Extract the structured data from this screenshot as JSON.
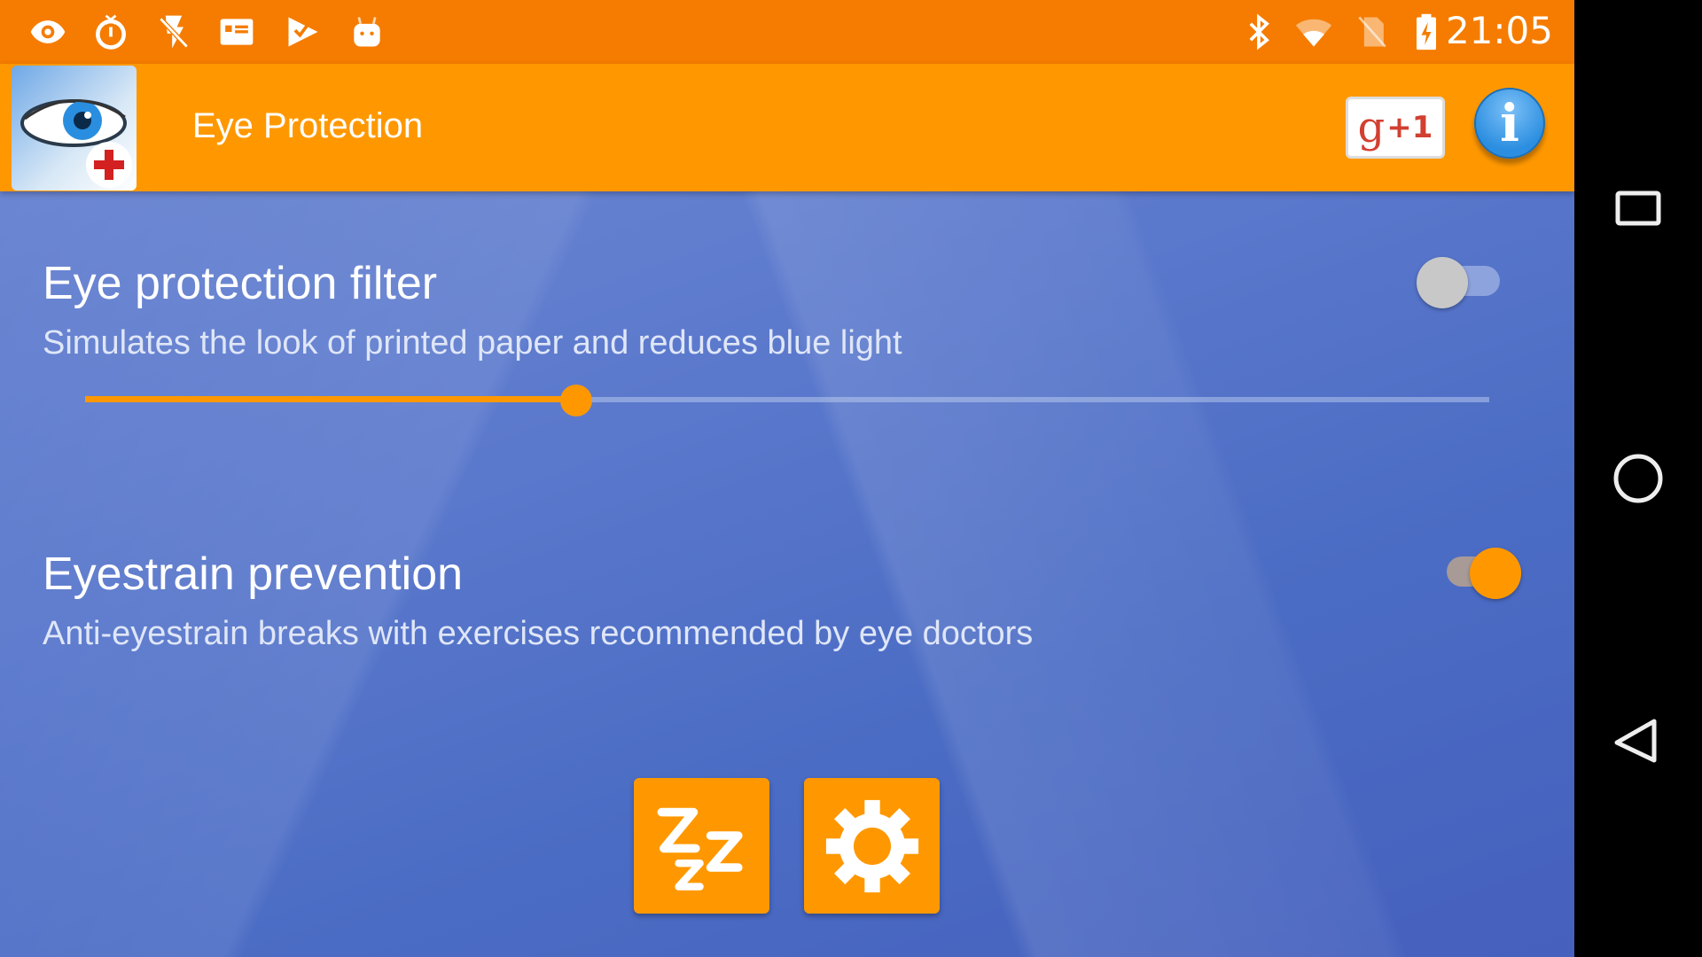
{
  "status_bar": {
    "left_icons": [
      "eye-icon",
      "stopwatch-icon",
      "flash-off-icon",
      "news-card-icon",
      "check-flag-icon",
      "android-icon"
    ],
    "right_icons": [
      "bluetooth-icon",
      "wifi-icon",
      "no-sim-icon",
      "battery-charging-icon"
    ],
    "time": "21:05"
  },
  "app_bar": {
    "title": "Eye Protection",
    "app_icon": "eye-with-red-cross-icon",
    "gplus_label": "g",
    "gplus_suffix": "+1",
    "info_label": "i"
  },
  "settings": [
    {
      "title": "Eye protection filter",
      "subtitle": "Simulates the look of printed paper and reduces blue light",
      "enabled": false,
      "slider_value_percent": 35
    },
    {
      "title": "Eyestrain prevention",
      "subtitle": "Anti-eyestrain breaks with exercises recommended by eye doctors",
      "enabled": true
    }
  ],
  "bottom_buttons": [
    {
      "name": "sleep",
      "icon": "zzz-icon"
    },
    {
      "name": "settings",
      "icon": "gear-icon"
    }
  ],
  "colors": {
    "status_bar": "#f57c00",
    "app_bar": "#ff9800",
    "accent": "#ff9800",
    "background": "#5a78cc"
  },
  "nav_bar": [
    "recents-button",
    "home-button",
    "back-button"
  ]
}
